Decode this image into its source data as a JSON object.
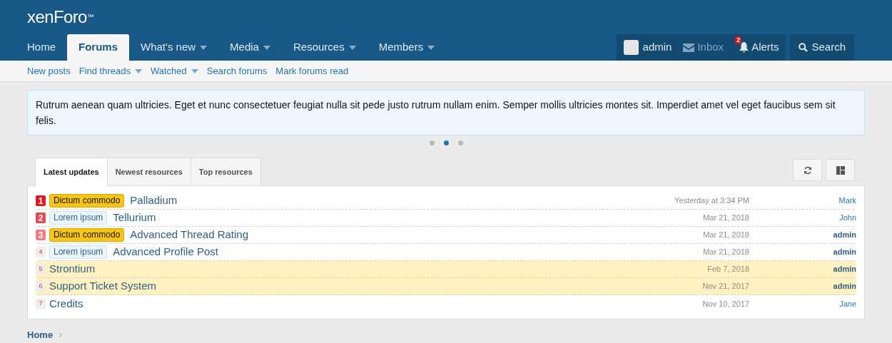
{
  "logo": {
    "text": "xenForo",
    "mark": "™"
  },
  "nav": [
    {
      "label": "Home",
      "selected": false,
      "dropdown": false
    },
    {
      "label": "Forums",
      "selected": true,
      "dropdown": false
    },
    {
      "label": "What's new",
      "selected": false,
      "dropdown": true
    },
    {
      "label": "Media",
      "selected": false,
      "dropdown": true
    },
    {
      "label": "Resources",
      "selected": false,
      "dropdown": true
    },
    {
      "label": "Members",
      "selected": false,
      "dropdown": true
    }
  ],
  "account": {
    "username": "admin",
    "inbox": "Inbox",
    "alerts": "Alerts",
    "alerts_count": "2",
    "search": "Search"
  },
  "subnav": [
    {
      "label": "New posts",
      "dropdown": false
    },
    {
      "label": "Find threads",
      "dropdown": true
    },
    {
      "label": "Watched",
      "dropdown": true
    },
    {
      "label": "Search forums",
      "dropdown": false
    },
    {
      "label": "Mark forums read",
      "dropdown": false
    }
  ],
  "notice": {
    "text": "Rutrum aenean quam ultricies. Eget et nunc consectetuer feugiat nulla sit pede justo rutrum nullam enim. Semper mollis ultricies montes sit. Imperdiet amet vel eget faucibus sem sit felis.",
    "slides": [
      {
        "selected": false
      },
      {
        "selected": true
      },
      {
        "selected": false
      }
    ]
  },
  "tabs": [
    {
      "label": "Latest updates",
      "selected": true
    },
    {
      "label": "Newest resources",
      "selected": false
    },
    {
      "label": "Top resources",
      "selected": false
    }
  ],
  "rows": [
    {
      "rank": "1",
      "color": "#e0181f",
      "prefix": {
        "text": "Dictum commodo",
        "kind": "warning"
      },
      "title": "Palladium",
      "date": "Yesterday at 3:34 PM",
      "author": "Mark",
      "staff": false,
      "featured": false
    },
    {
      "rank": "2",
      "color": "#e8484e",
      "prefix": {
        "text": "Lorem ipsum",
        "kind": "info"
      },
      "title": "Tellurium",
      "date": "Mar 21, 2018",
      "author": "John",
      "staff": false,
      "featured": false
    },
    {
      "rank": "3",
      "color": "#f07d80",
      "prefix": {
        "text": "Dictum commodo",
        "kind": "warning"
      },
      "title": "Advanced Thread Rating",
      "date": "Mar 21, 2018",
      "author": "admin",
      "staff": true,
      "featured": false
    },
    {
      "rank": "4",
      "prefix": {
        "text": "Lorem ipsum",
        "kind": "info"
      },
      "title": "Advanced Profile Post",
      "date": "Mar 21, 2018",
      "author": "admin",
      "staff": true,
      "featured": false
    },
    {
      "rank": "5",
      "title": "Strontium",
      "date": "Feb 7, 2018",
      "author": "admin",
      "staff": true,
      "featured": true
    },
    {
      "rank": "6",
      "title": "Support Ticket System",
      "date": "Nov 21, 2017",
      "author": "admin",
      "staff": true,
      "featured": true
    },
    {
      "rank": "7",
      "title": "Credits",
      "date": "Nov 10, 2017",
      "author": "Jane",
      "staff": false,
      "featured": false
    }
  ],
  "breadcrumb": [
    {
      "label": "Home"
    }
  ]
}
